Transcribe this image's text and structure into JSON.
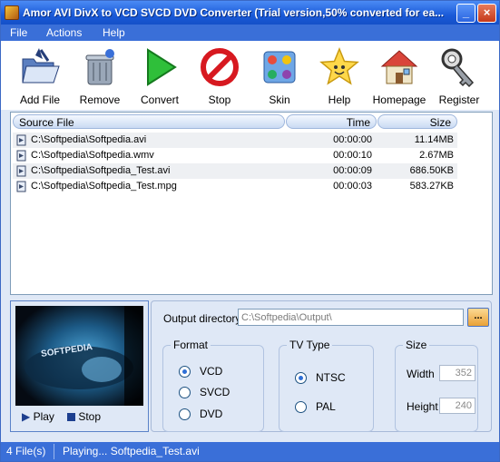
{
  "window": {
    "title": "Amor AVI DivX to VCD SVCD DVD Converter  (Trial version,50% converted for ea...",
    "minimize_glyph": "_",
    "close_glyph": "×"
  },
  "menu": [
    "File",
    "Actions",
    "Help"
  ],
  "toolbar": [
    {
      "label": "Add File",
      "icon": "open-folder-icon"
    },
    {
      "label": "Remove",
      "icon": "trash-can-icon"
    },
    {
      "label": "Convert",
      "icon": "play-arrow-icon"
    },
    {
      "label": "Stop",
      "icon": "stop-sign-icon"
    },
    {
      "label": "Skin",
      "icon": "skin-palette-icon"
    },
    {
      "label": "Help",
      "icon": "star-face-icon"
    },
    {
      "label": "Homepage",
      "icon": "house-icon"
    },
    {
      "label": "Register",
      "icon": "key-icon"
    }
  ],
  "file_list": {
    "columns": {
      "source": "Source File",
      "time": "Time",
      "size": "Size"
    },
    "rows": [
      {
        "name": "C:\\Softpedia\\Softpedia.avi",
        "time": "00:00:00",
        "size": "11.14MB"
      },
      {
        "name": "C:\\Softpedia\\Softpedia.wmv",
        "time": "00:00:10",
        "size": "2.67MB"
      },
      {
        "name": "C:\\Softpedia\\Softpedia_Test.avi",
        "time": "00:00:09",
        "size": "686.50KB"
      },
      {
        "name": "C:\\Softpedia\\Softpedia_Test.mpg",
        "time": "00:00:03",
        "size": "583.27KB"
      }
    ]
  },
  "preview": {
    "overlay_text": "SOFTPEDIA",
    "play_label": "Play",
    "stop_label": "Stop"
  },
  "output": {
    "label": "Output directory:",
    "value": "C:\\Softpedia\\Output\\",
    "browse_label": "..."
  },
  "format": {
    "title": "Format",
    "options": [
      "VCD",
      "SVCD",
      "DVD"
    ],
    "selected": "VCD"
  },
  "tv_type": {
    "title": "TV Type",
    "options": [
      "NTSC",
      "PAL"
    ],
    "selected": "NTSC"
  },
  "size": {
    "title": "Size",
    "width_label": "Width",
    "width_value": "352",
    "height_label": "Height",
    "height_value": "240"
  },
  "status": {
    "file_count": "4 File(s)",
    "message": "Playing... Softpedia_Test.avi"
  },
  "colors": {
    "title_bar": "#1a5ad8",
    "panel_bg": "#dfe8f6",
    "status_bar": "#3a6fd8"
  }
}
